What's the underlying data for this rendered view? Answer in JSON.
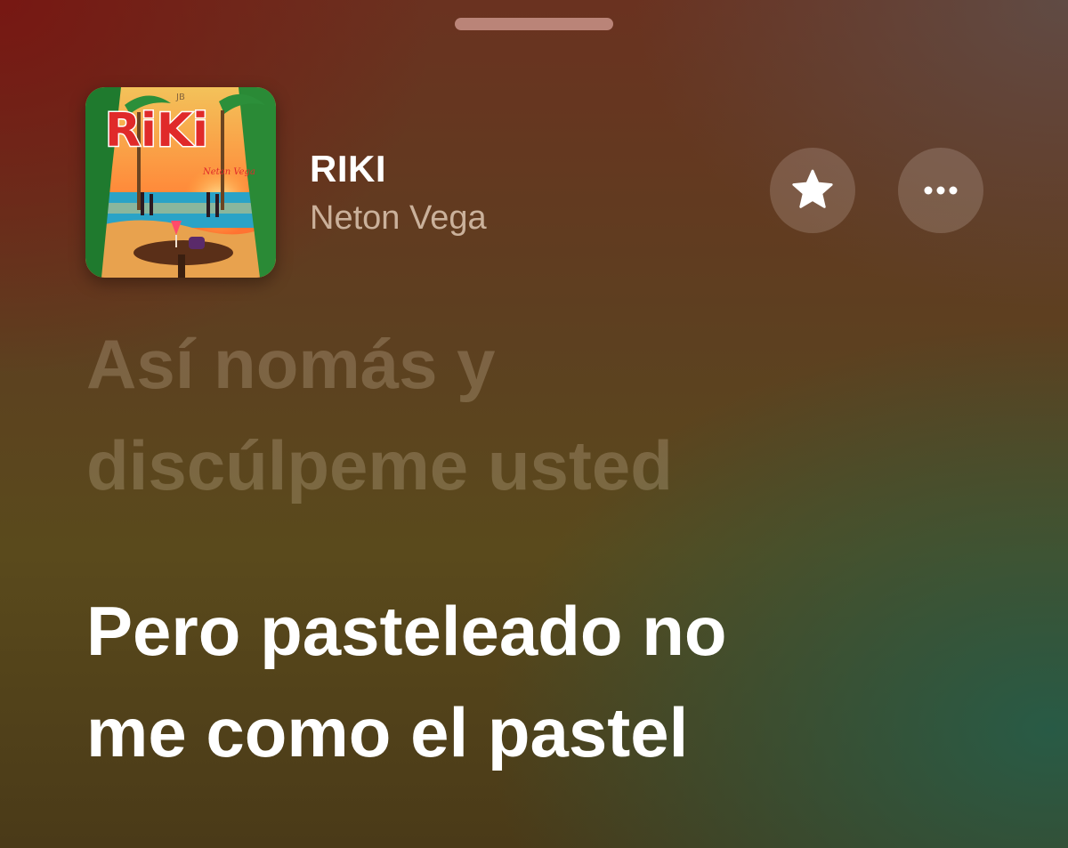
{
  "now_playing": {
    "title": "RIKI",
    "artist": "Neton Vega",
    "artwork": {
      "label": "RiKi",
      "subtitle": "Neton Vega",
      "badge": "JB",
      "colors": {
        "sky_top": "#f6b04a",
        "sky_bottom": "#ff7a32",
        "title": "#e02a2a",
        "sea": "#2aa3c7",
        "sand": "#e8a24e",
        "palm": "#1f7a2e"
      }
    }
  },
  "controls": {
    "favorite_icon": "star-icon",
    "more_icon": "ellipsis-icon"
  },
  "lyrics": {
    "previous": [
      "Así nomás y",
      "discúlpeme usted"
    ],
    "current": [
      "Pero pasteleado no",
      "me como el pastel"
    ]
  }
}
